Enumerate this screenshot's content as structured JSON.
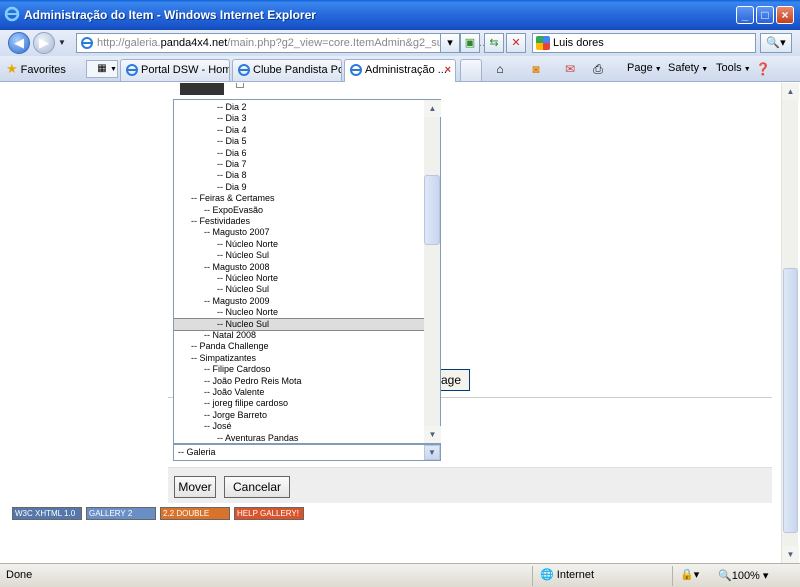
{
  "window": {
    "title": "Administração do Item - Windows Internet Explorer",
    "minimize": "_",
    "maximize": "□",
    "close": "×"
  },
  "addressbar": {
    "url_prefix": "http://galeria.",
    "url_host": "panda4x4.net",
    "url_rest": "/main.php?g2_view=core.ItemAdmin&g2_subView=...",
    "search_value": "Luis dores"
  },
  "favorites": {
    "label": "Favorites"
  },
  "tabs": [
    {
      "label": "Portal DSW - Home"
    },
    {
      "label": "Clube Pandista Po..."
    },
    {
      "label": "Administração ..."
    }
  ],
  "commandbar": {
    "page": "Page",
    "safety": "Safety",
    "tools": "Tools"
  },
  "content": {
    "partial_button": "age",
    "tree_items": [
      "-- Dia 2",
      "-- Dia 3",
      "-- Dia 4",
      "-- Dia 5",
      "-- Dia 6",
      "-- Dia 7",
      "-- Dia 8",
      "-- Dia 9",
      "-- Feiras & Certames",
      "-- ExpoEvasão",
      "-- Festividades",
      "-- Magusto 2007",
      "-- Núcleo Norte",
      "-- Núcleo Sul",
      "-- Magusto 2008",
      "-- Núcleo Norte",
      "-- Núcleo Sul",
      "-- Magusto 2009",
      "-- Nucleo Norte",
      "-- Nucleo Sul",
      "-- Natal 2008",
      "-- Panda Challenge",
      "-- Simpatizantes",
      "-- Filipe Cardoso",
      "-- João Pedro Reis Mota",
      "-- João Valente",
      "-- joreg filipe cardoso",
      "-- Jorge Barreto",
      "-- José",
      "-- Aventuras Pandas"
    ],
    "tree_levels": [
      3,
      3,
      3,
      3,
      3,
      3,
      3,
      3,
      1,
      2,
      1,
      2,
      3,
      3,
      2,
      3,
      3,
      2,
      3,
      3,
      2,
      1,
      1,
      2,
      2,
      2,
      2,
      2,
      2,
      3
    ],
    "selected_index": 19,
    "select_value": "-- Galeria",
    "move_button": "Mover",
    "cancel_button": "Cancelar",
    "badges": [
      {
        "text": "W3C XHTML 1.0",
        "color": "#5577aa"
      },
      {
        "text": "GALLERY 2",
        "color": "#6a8fc7"
      },
      {
        "text": "2.2 DOUBLE",
        "color": "#d9732b"
      },
      {
        "text": "HELP GALLERY!",
        "color": "#d9542b"
      }
    ]
  },
  "status": {
    "text": "Done",
    "zone": "Internet",
    "zoom": "100%"
  }
}
